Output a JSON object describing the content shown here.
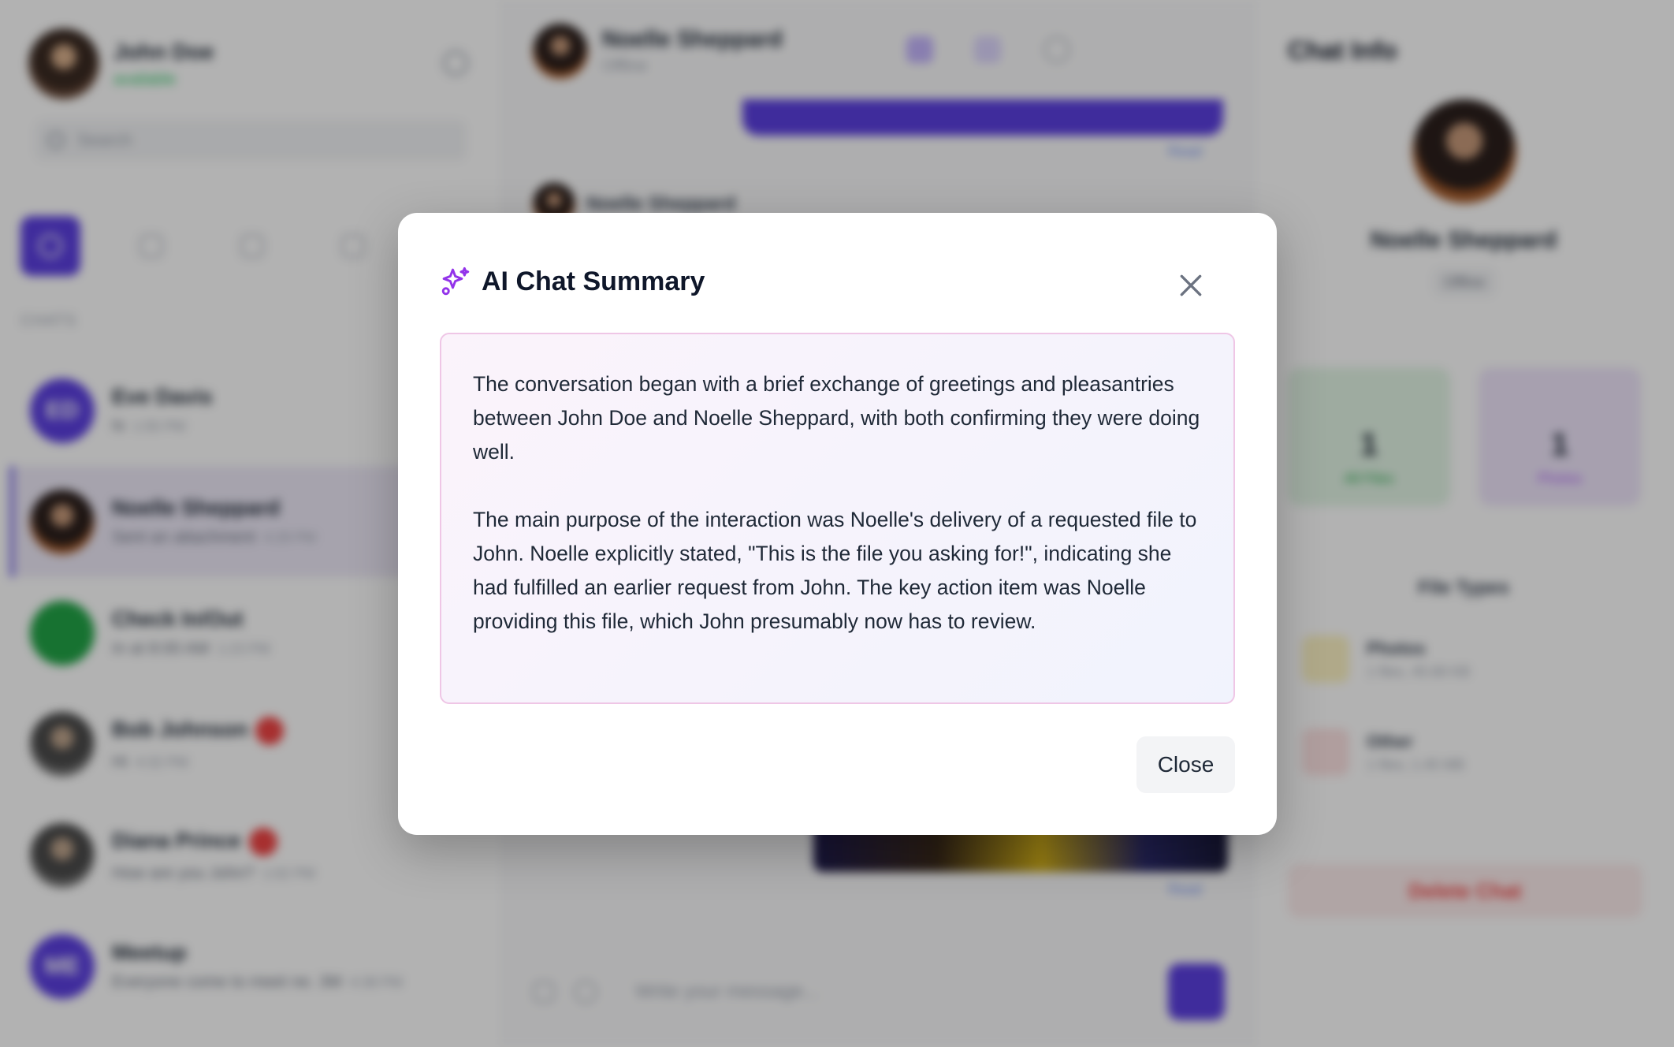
{
  "sidebar": {
    "user": {
      "name": "John Doe",
      "status": "available"
    },
    "search_placeholder": "Search",
    "section_label": "CHATS",
    "chats": [
      {
        "name": "Eve Davis",
        "initials": "ED",
        "preview": "hi",
        "time": "1:55 PM",
        "color": "#5b3fe0"
      },
      {
        "name": "Noelle Sheppard",
        "initials": "",
        "preview": "Sent an attachment",
        "time": "4:29 PM"
      },
      {
        "name": "Check In/Out",
        "initials": "",
        "preview": "In at 8:00 AM",
        "time": "1:23 PM",
        "color": "#22a447"
      },
      {
        "name": "Bob Johnson",
        "initials": "",
        "preview": "Hi",
        "time": "4:32 PM"
      },
      {
        "name": "Diana Prince",
        "initials": "",
        "preview": "How are you John?",
        "time": "1:02 PM"
      },
      {
        "name": "Meetup",
        "initials": "ME",
        "preview": "Everyone come to meet ne. 3M",
        "time": "4:38 PM",
        "color": "#5b3fe0"
      }
    ]
  },
  "chat": {
    "contact_name": "Noelle Sheppard",
    "contact_status": "Offline",
    "composer_placeholder": "Write your message...",
    "read_label": "Read"
  },
  "info": {
    "title": "Chat Info",
    "name": "Noelle Sheppard",
    "status": "Offline",
    "stats": [
      {
        "value": "1",
        "label": "All Files"
      },
      {
        "value": "1",
        "label": "Photos"
      }
    ],
    "file_types_title": "File Types",
    "file_types": [
      {
        "name": "Photos",
        "meta": "1 files, 45.68 KB"
      },
      {
        "name": "Other",
        "meta": "1 files, 1.45 MB"
      }
    ],
    "delete_label": "Delete Chat"
  },
  "modal": {
    "title": "AI Chat Summary",
    "paragraphs": [
      "The conversation began with a brief exchange of greetings and pleasantries between John Doe and Noelle Sheppard, with both confirming they were doing well.",
      "The main purpose of the interaction was Noelle's delivery of a requested file to John. Noelle explicitly stated, \"This is the file you asking for!\", indicating she had fulfilled an earlier request from John. The key action item was Noelle providing this file, which John presumably now has to review."
    ],
    "close_label": "Close",
    "colors": {
      "accent": "#9333ea",
      "box_border": "#efc6e6"
    }
  }
}
